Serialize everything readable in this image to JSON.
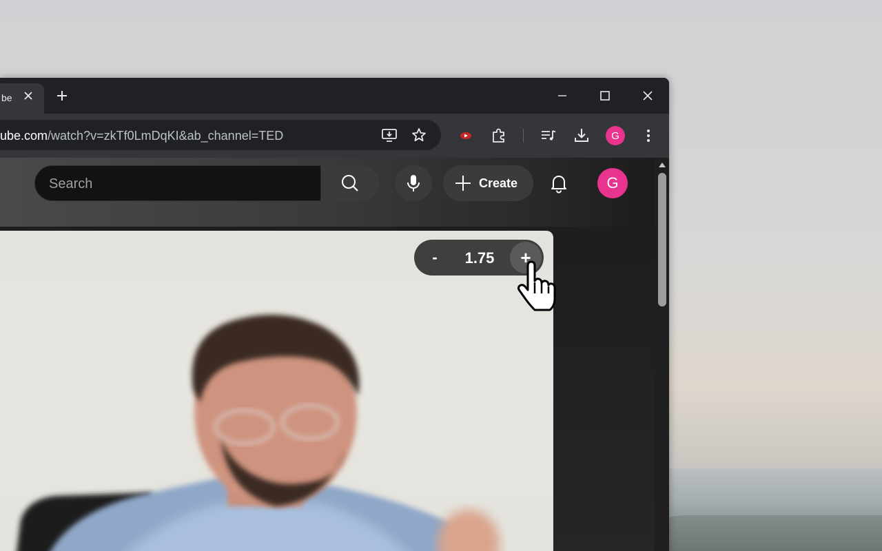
{
  "browser": {
    "tab_title": "be",
    "url_host": "ube.com",
    "url_path": "/watch?v=zkTf0LmDqKI&ab_channel=TED",
    "profile_initial": "G"
  },
  "youtube": {
    "search_placeholder": "Search",
    "create_label": "Create",
    "avatar_initial": "G"
  },
  "player": {
    "speed_minus": "-",
    "speed_value": "1.75",
    "speed_plus": "+"
  },
  "colors": {
    "avatar": "#e8348e",
    "chrome_dark": "#202124",
    "chrome_toolbar": "#35363a"
  },
  "icons": [
    "close-icon",
    "plus-icon",
    "minimize-icon",
    "maximize-icon",
    "install-app-icon",
    "star-icon",
    "extension-icon",
    "puzzle-icon",
    "media-icon",
    "download-icon",
    "menu-icon",
    "search-icon",
    "mic-icon",
    "bell-icon",
    "hand-cursor-icon"
  ]
}
